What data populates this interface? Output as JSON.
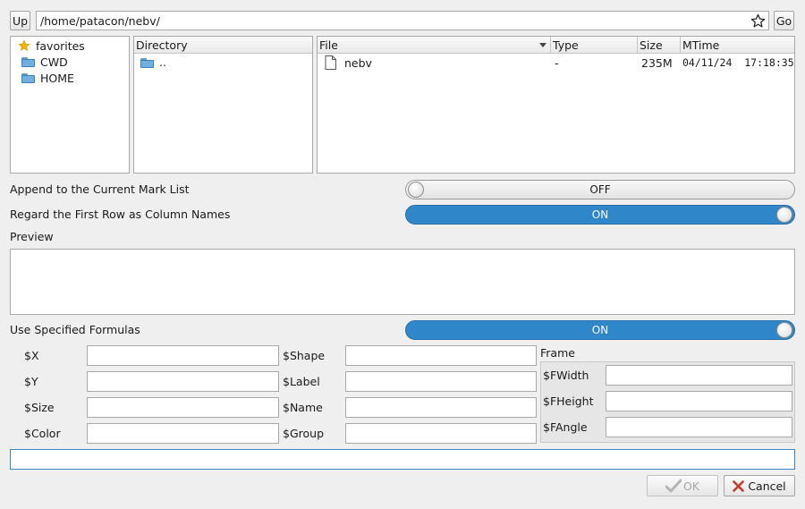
{
  "toolbar": {
    "up_label": "Up",
    "path_value": "/home/patacon/nebv/",
    "go_label": "Go"
  },
  "places": {
    "items": [
      {
        "label": "favorites",
        "icon": "star-icon"
      },
      {
        "label": "CWD",
        "icon": "folder-icon"
      },
      {
        "label": "HOME",
        "icon": "folder-icon"
      }
    ]
  },
  "directory": {
    "header": "Directory",
    "items": [
      {
        "label": "..",
        "icon": "folder-icon"
      }
    ]
  },
  "files": {
    "headers": {
      "file": "File",
      "type": "Type",
      "size": "Size",
      "mtime": "MTime"
    },
    "rows": [
      {
        "name": "nebv",
        "type": "-",
        "size": "235M",
        "mtime": "04/11/24  17:18:35",
        "icon": "file-icon"
      }
    ]
  },
  "options": {
    "append_label": "Append to the Current Mark List",
    "append_state": "OFF",
    "first_row_label": "Regard the First Row as Column Names",
    "first_row_state": "ON",
    "preview_label": "Preview",
    "formulas_label": "Use Specified Formulas",
    "formulas_state": "ON"
  },
  "formulas": {
    "left": [
      "$X",
      "$Y",
      "$Size",
      "$Color"
    ],
    "middle": [
      "$Shape",
      "$Label",
      "$Name",
      "$Group"
    ],
    "frame_title": "Frame",
    "frame": [
      "$FWidth",
      "$FHeight",
      "$FAngle"
    ]
  },
  "buttons": {
    "ok_label": "OK",
    "cancel_label": "Cancel"
  },
  "colors": {
    "accent": "#2f86c8",
    "star": "#f2b400",
    "folder": "#6fb0e0",
    "cancel_x": "#c0392b"
  }
}
